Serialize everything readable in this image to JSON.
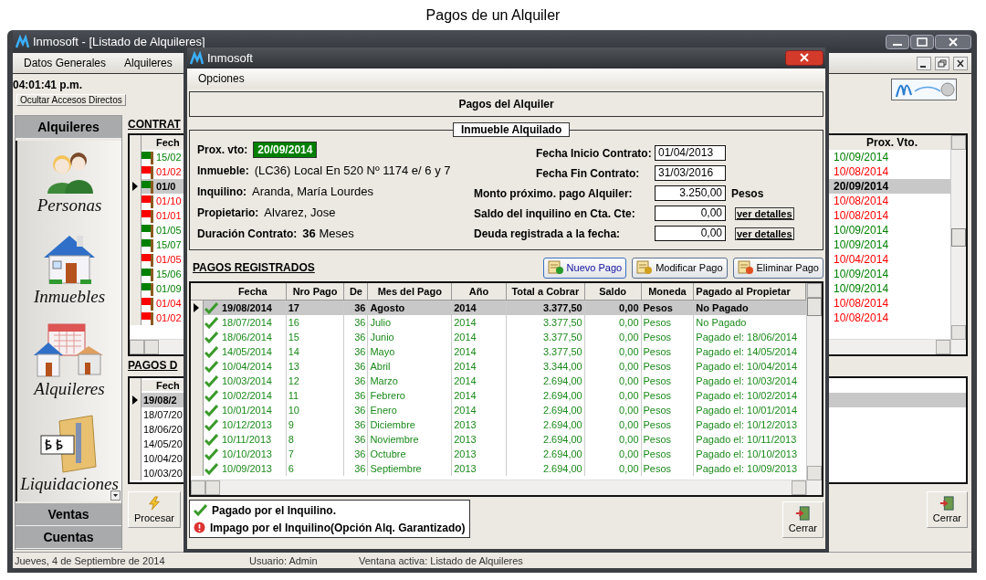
{
  "page_title": "Pagos de un Alquiler",
  "main_window": {
    "title": "Inmosoft - [Listado de Alquileres]",
    "menu": [
      "Datos Generales",
      "Alquileres"
    ],
    "clock": "04:01:41 p.m.",
    "toggle_button": "Ocultar Accesos Directos",
    "sidebar": {
      "header": "Alquileres",
      "items": [
        {
          "kind": "people",
          "label": "Personas"
        },
        {
          "kind": "house",
          "label": "Inmuebles"
        },
        {
          "kind": "rentals",
          "label": "Alquileres"
        },
        {
          "kind": "settlements",
          "label": "Liquidaciones"
        }
      ],
      "sections": [
        "Ventas",
        "Cuentas"
      ]
    },
    "contracts": {
      "title": "CONTRAT",
      "columns": [
        "Fech",
        "Prox. Vto."
      ],
      "rows": [
        {
          "fecha": "15/02",
          "prox_vto": "10/09/2014",
          "color": "#008000",
          "selected": false
        },
        {
          "fecha": "01/02",
          "prox_vto": "10/08/2014",
          "color": "#ff0000",
          "selected": false
        },
        {
          "fecha": "01/0",
          "prox_vto": "20/09/2014",
          "color": "#008000",
          "selected": true
        },
        {
          "fecha": "01/10",
          "prox_vto": "10/08/2014",
          "color": "#ff0000",
          "selected": false
        },
        {
          "fecha": "01/01",
          "prox_vto": "10/08/2014",
          "color": "#ff0000",
          "selected": false
        },
        {
          "fecha": "01/05",
          "prox_vto": "10/09/2014",
          "color": "#008000",
          "selected": false
        },
        {
          "fecha": "15/07",
          "prox_vto": "10/09/2014",
          "color": "#008000",
          "selected": false
        },
        {
          "fecha": "01/05",
          "prox_vto": "10/04/2014",
          "color": "#ff0000",
          "selected": false
        },
        {
          "fecha": "15/06",
          "prox_vto": "10/09/2014",
          "color": "#008000",
          "selected": false
        },
        {
          "fecha": "01/09",
          "prox_vto": "10/09/2014",
          "color": "#008000",
          "selected": false
        },
        {
          "fecha": "01/04",
          "prox_vto": "10/08/2014",
          "color": "#ff0000",
          "selected": false
        },
        {
          "fecha": "01/02",
          "prox_vto": "10/08/2014",
          "color": "#ff0000",
          "selected": false
        }
      ]
    },
    "payments": {
      "title": "PAGOS D",
      "columns": [
        "Fech"
      ],
      "rows": [
        {
          "fecha": "19/08/2",
          "selected": true
        },
        {
          "fecha": "18/07/20",
          "selected": false
        },
        {
          "fecha": "18/06/20",
          "selected": false
        },
        {
          "fecha": "14/05/20",
          "selected": false
        },
        {
          "fecha": "10/04/20",
          "selected": false
        },
        {
          "fecha": "10/03/20",
          "selected": false
        }
      ]
    },
    "process_button": "Procesar",
    "close_button": "Cerrar",
    "status_bar": [
      "Jueves, 4 de Septiembre de 2014",
      "Usuario: Admin",
      "Ventana activa: Listado de Alquileres"
    ]
  },
  "dialog": {
    "title": "Inmosoft",
    "menu": [
      "Opciones"
    ],
    "header": "Pagos del Alquiler",
    "property": {
      "legend": "Inmueble Alquilado",
      "left_fields": [
        {
          "kind": "highlight",
          "label": "Prox. vto:",
          "value": "20/09/2014"
        },
        {
          "kind": "text",
          "label": "Inmueble:",
          "value": "(LC36) Local En  520 Nº 1174 e/ 6 y 7"
        },
        {
          "kind": "text",
          "label": "Inquilino:",
          "value": "Aranda, María Lourdes"
        },
        {
          "kind": "text",
          "label": "Propietario:",
          "value": "Alvarez, Jose"
        },
        {
          "kind": "text",
          "label": "Duración Contrato:",
          "value": "**36** Meses"
        }
      ],
      "right_fields": [
        {
          "kind": "date",
          "label": "Fecha Inicio Contrato:",
          "value": "01/04/2013"
        },
        {
          "kind": "date",
          "label": "Fecha Fin Contrato:",
          "value": "31/03/2016"
        },
        {
          "kind": "amount",
          "label": "Monto próximo. pago Alquiler:",
          "value": "3.250,00",
          "suffix": "Pesos"
        },
        {
          "kind": "amount",
          "label": "Saldo del inquilino en Cta. Cte:",
          "value": "0,00",
          "link": "ver detalles"
        },
        {
          "kind": "amount",
          "label": "Deuda registrada a la fecha:",
          "value": "0,00",
          "link": "ver detalles"
        }
      ]
    },
    "payments_title": "PAGOS REGISTRADOS",
    "actions": [
      {
        "kind": "new",
        "label": "Nuevo Pago"
      },
      {
        "kind": "edit",
        "label": "Modificar Pago"
      },
      {
        "kind": "delete",
        "label": "Eliminar Pago"
      }
    ],
    "table": {
      "columns": [
        "Fecha",
        "Nro Pago",
        "De",
        "Mes del Pago",
        "Año",
        "Total a Cobrar",
        "Saldo",
        "Moneda",
        "Pagado al Propietar"
      ],
      "rows": [
        {
          "paid": true,
          "selected": true,
          "cells": [
            "19/08/2014",
            "17",
            "36",
            "Agosto",
            "2014",
            "3.377,50",
            "0,00",
            "Pesos",
            "No Pagado"
          ]
        },
        {
          "paid": true,
          "selected": false,
          "cells": [
            "18/07/2014",
            "16",
            "36",
            "Julio",
            "2014",
            "3.377,50",
            "0,00",
            "Pesos",
            "No Pagado"
          ]
        },
        {
          "paid": true,
          "selected": false,
          "cells": [
            "18/06/2014",
            "15",
            "36",
            "Junio",
            "2014",
            "3.377,50",
            "0,00",
            "Pesos",
            "Pagado el: 18/06/2014"
          ]
        },
        {
          "paid": true,
          "selected": false,
          "cells": [
            "14/05/2014",
            "14",
            "36",
            "Mayo",
            "2014",
            "3.377,50",
            "0,00",
            "Pesos",
            "Pagado el: 14/05/2014"
          ]
        },
        {
          "paid": true,
          "selected": false,
          "cells": [
            "10/04/2014",
            "13",
            "36",
            "Abril",
            "2014",
            "3.344,00",
            "0,00",
            "Pesos",
            "Pagado el: 10/04/2014"
          ]
        },
        {
          "paid": true,
          "selected": false,
          "cells": [
            "10/03/2014",
            "12",
            "36",
            "Marzo",
            "2014",
            "2.694,00",
            "0,00",
            "Pesos",
            "Pagado el: 10/03/2014"
          ]
        },
        {
          "paid": true,
          "selected": false,
          "cells": [
            "10/02/2014",
            "11",
            "36",
            "Febrero",
            "2014",
            "2.694,00",
            "0,00",
            "Pesos",
            "Pagado el: 10/02/2014"
          ]
        },
        {
          "paid": true,
          "selected": false,
          "cells": [
            "10/01/2014",
            "10",
            "36",
            "Enero",
            "2014",
            "2.694,00",
            "0,00",
            "Pesos",
            "Pagado el: 10/01/2014"
          ]
        },
        {
          "paid": true,
          "selected": false,
          "cells": [
            "10/12/2013",
            "9",
            "36",
            "Diciembre",
            "2013",
            "2.694,00",
            "0,00",
            "Pesos",
            "Pagado el: 10/12/2013"
          ]
        },
        {
          "paid": true,
          "selected": false,
          "cells": [
            "10/11/2013",
            "8",
            "36",
            "Noviembre",
            "2013",
            "2.694,00",
            "0,00",
            "Pesos",
            "Pagado el: 10/11/2013"
          ]
        },
        {
          "paid": true,
          "selected": false,
          "cells": [
            "10/10/2013",
            "7",
            "36",
            "Octubre",
            "2013",
            "2.694,00",
            "0,00",
            "Pesos",
            "Pagado el: 10/10/2013"
          ]
        },
        {
          "paid": true,
          "selected": false,
          "cells": [
            "10/09/2013",
            "6",
            "36",
            "Septiembre",
            "2013",
            "2.694,00",
            "0,00",
            "Pesos",
            "Pagado el: 10/09/2013"
          ]
        }
      ]
    },
    "legend": [
      {
        "kind": "paid",
        "label": "Pagado por el Inquilino."
      },
      {
        "kind": "unpaid",
        "label": "Impago por el Inquilino(Opción Alq. Garantizado)"
      }
    ],
    "close_button": "Cerrar"
  }
}
